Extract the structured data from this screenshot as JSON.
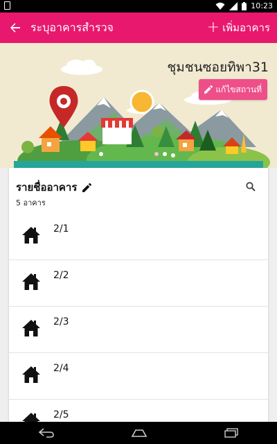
{
  "status_bar": {
    "time": "10:23",
    "icons": [
      "notification-icon",
      "wifi-icon",
      "signal-icon",
      "battery-icon"
    ]
  },
  "app_bar": {
    "title": "ระบุอาคารสำรวจ",
    "add_label": "เพิ่มอาคาร",
    "back_icon": "arrow-back-icon",
    "color": "#e8186e"
  },
  "header": {
    "community_name": "ชุมชนซอยทิพา31",
    "edit_place_label": "แก้ไขสถานที่",
    "edit_icon": "pencil-icon",
    "background": "#f1ead1"
  },
  "building_list": {
    "title": "รายชื่ออาคาร",
    "count_label": "5 อาคาร",
    "items": [
      {
        "label": "2/1"
      },
      {
        "label": "2/2"
      },
      {
        "label": "2/3"
      },
      {
        "label": "2/4"
      },
      {
        "label": "2/5"
      }
    ]
  },
  "nav_bar": {
    "icons": [
      "back-nav-icon",
      "home-nav-icon",
      "recent-apps-icon"
    ]
  }
}
